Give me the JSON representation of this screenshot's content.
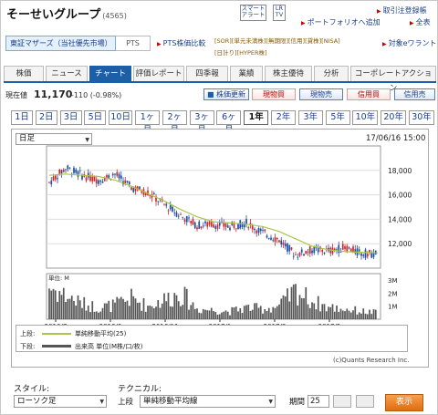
{
  "header": {
    "company": "そーせいグループ",
    "code": "(4565)",
    "btn_smart": "スマート",
    "btn_alert": "アラート",
    "btn_lr": "LR",
    "btn_tv": "TV",
    "link_trade": "取引注登録帳",
    "link_portfolio": "ポートフォリオへ追加",
    "link_all": "全表"
  },
  "market": {
    "label": "東証マザーズ（当社優先市場）",
    "pts": "PTS",
    "pts_compare": "PTS株価比較",
    "badges": [
      "[SOR]",
      "[単元未満株]",
      "[無期限]",
      "[信用]",
      "[貸株]",
      "[NISA]",
      "[日計り]",
      "[HYPER株]"
    ],
    "fav": "対象eワラント"
  },
  "nav": {
    "tabs": [
      "株価",
      "ニュース",
      "チャート",
      "評価レポート",
      "四季報",
      "業績",
      "株主優待",
      "分析",
      "コーポレートアクション"
    ],
    "active": 2
  },
  "quote": {
    "label": "現在値",
    "price": "11,170",
    "change": "-110 (-0.98%)",
    "update_btn": "株価更新",
    "buy_spot": "現物買",
    "sell_spot": "現物売",
    "buy_margin": "信用買",
    "sell_margin": "信用売"
  },
  "periods": {
    "items": [
      "1日",
      "2日",
      "3日",
      "5日",
      "10日",
      "1ヶ月",
      "2ヶ月",
      "3ヶ月",
      "6ヶ月",
      "1年",
      "2年",
      "3年",
      "5年",
      "10年",
      "20年",
      "30年"
    ],
    "active": 9
  },
  "chart": {
    "interval": "日足",
    "timestamp": "17/06/16 15:00",
    "yticks": [
      "18,000",
      "16,000",
      "14,000",
      "12,000"
    ],
    "vol_ticks": [
      "3M",
      "2M",
      "1M"
    ],
    "vol_unit": "単位: M",
    "xticks": [
      "2016/7",
      "2016/9",
      "2016/11",
      "2017/1",
      "2017/3",
      "2017/5"
    ],
    "legend_top_lbl": "上段:",
    "legend_top": "単純移動平均(25)",
    "legend_bot_lbl": "下段:",
    "legend_bot": "出来高 単位(M株/口/枚)",
    "credit": "(c)Quants Research Inc."
  },
  "chart_data": {
    "type": "candlestick",
    "y_range": [
      10000,
      20000
    ],
    "vol_range": [
      0,
      3.5
    ],
    "ma": [
      17600,
      17700,
      17600,
      17500,
      17200,
      16700,
      16100,
      15500,
      14800,
      14200,
      13800,
      13700,
      13600,
      13400,
      13000,
      12400,
      11800,
      11500,
      11350,
      11300,
      11250
    ],
    "close": [
      17000,
      18200,
      17600,
      17200,
      17700,
      16600,
      16200,
      15200,
      14300,
      13500,
      13600,
      13400,
      13700,
      12900,
      12300,
      11100,
      11500,
      11400,
      11700,
      11200,
      11170
    ],
    "volume": [
      2.5,
      1.8,
      1.2,
      0.9,
      1.1,
      1.6,
      1.0,
      1.5,
      2.0,
      0.8,
      0.7,
      0.6,
      0.9,
      0.8,
      1.0,
      2.2,
      1.4,
      0.9,
      0.8,
      0.6,
      0.5
    ]
  },
  "controls": {
    "style_lbl": "スタイル:",
    "style_val": "ローソク足",
    "tech_lbl": "テクニカル:",
    "tech_upper": "上段",
    "tech_val": "単純移動平均線",
    "period_lbl": "期間",
    "period_val": "25",
    "show": "表示"
  },
  "colors": {
    "accent": "#1d5fa6",
    "up": "#d0272b",
    "down": "#1d4ea0",
    "ma": "#a9c64a",
    "button": "#e8761c"
  }
}
